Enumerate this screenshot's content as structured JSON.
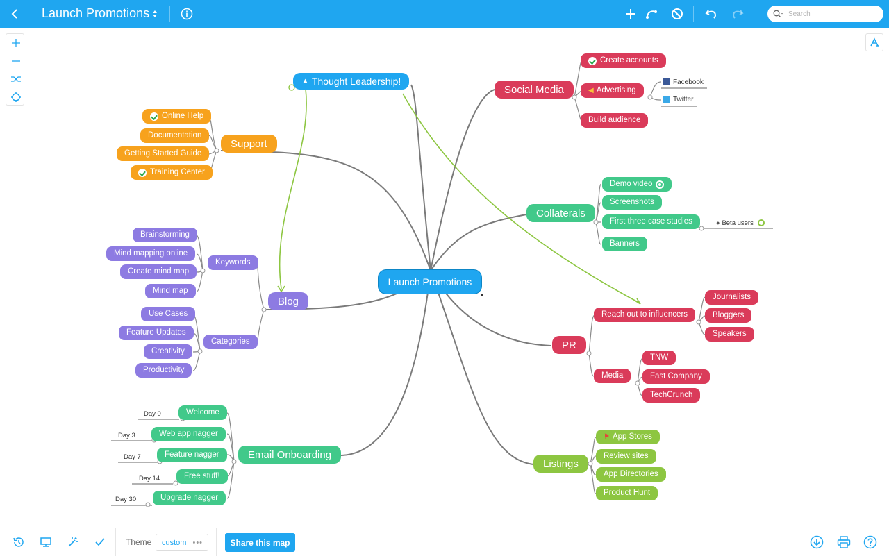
{
  "toolbar": {
    "back_icon": "chevron-left-icon",
    "title": "Launch Promotions",
    "title_menu_icon": "updown-chevron-icon",
    "info_icon": "info-icon",
    "add_icon": "plus-icon",
    "connect_icon": "connection-icon",
    "delete_icon": "no-entry-icon",
    "undo_icon": "undo-icon",
    "redo_icon": "redo-icon",
    "search_placeholder": "Search"
  },
  "map": {
    "central": "Launch Promotions",
    "thought_leadership": "Thought Leadership!",
    "support": {
      "label": "Support",
      "children": [
        "Online Help",
        "Documentation",
        "Getting Started Guide",
        "Training Center"
      ]
    },
    "blog": {
      "label": "Blog",
      "keywords": {
        "label": "Keywords",
        "children": [
          "Brainstorming",
          "Mind mapping online",
          "Create mind map",
          "Mind map"
        ]
      },
      "categories": {
        "label": "Categories",
        "children": [
          "Use Cases",
          "Feature Updates",
          "Creativity",
          "Productivity"
        ]
      }
    },
    "email": {
      "label": "Email Onboarding",
      "children": [
        "Welcome",
        "Web app nagger",
        "Feature nagger",
        "Free stuff!",
        "Upgrade nagger"
      ],
      "days": [
        "Day 0",
        "Day 3",
        "Day 7",
        "Day 14",
        "Day 30"
      ]
    },
    "social": {
      "label": "Social Media",
      "children": [
        "Create accounts",
        "Advertising",
        "Build audience"
      ],
      "advertising_children": [
        "Facebook",
        "Twitter"
      ]
    },
    "collaterals": {
      "label": "Collaterals",
      "children": [
        "Demo video",
        "Screenshots",
        "First three case studies",
        "Banners"
      ],
      "case_study_note": "Beta users"
    },
    "pr": {
      "label": "PR",
      "influencers": {
        "label": "Reach out to influencers",
        "children": [
          "Journalists",
          "Bloggers",
          "Speakers"
        ]
      },
      "media": {
        "label": "Media",
        "children": [
          "TNW",
          "Fast Company",
          "TechCrunch"
        ]
      }
    },
    "listings": {
      "label": "Listings",
      "children": [
        "App Stores",
        "Review sites",
        "App Directories",
        "Product Hunt"
      ]
    }
  },
  "bottom": {
    "history_icon": "history-icon",
    "present_icon": "monitor-icon",
    "magic_icon": "magic-wand-icon",
    "check_icon": "checkmark-icon",
    "theme_label": "Theme",
    "theme_value": "custom",
    "share_label": "Share this map",
    "download_icon": "download-icon",
    "print_icon": "printer-icon",
    "help_icon": "help-icon"
  },
  "colors": {
    "accent": "#1fa6f0",
    "support": "#f7a21d",
    "blog": "#8d7be2",
    "email": "#41c98a",
    "social": "#da3b5a",
    "collaterals": "#41c98a",
    "pr": "#da3b5a",
    "listings": "#8dc641"
  }
}
